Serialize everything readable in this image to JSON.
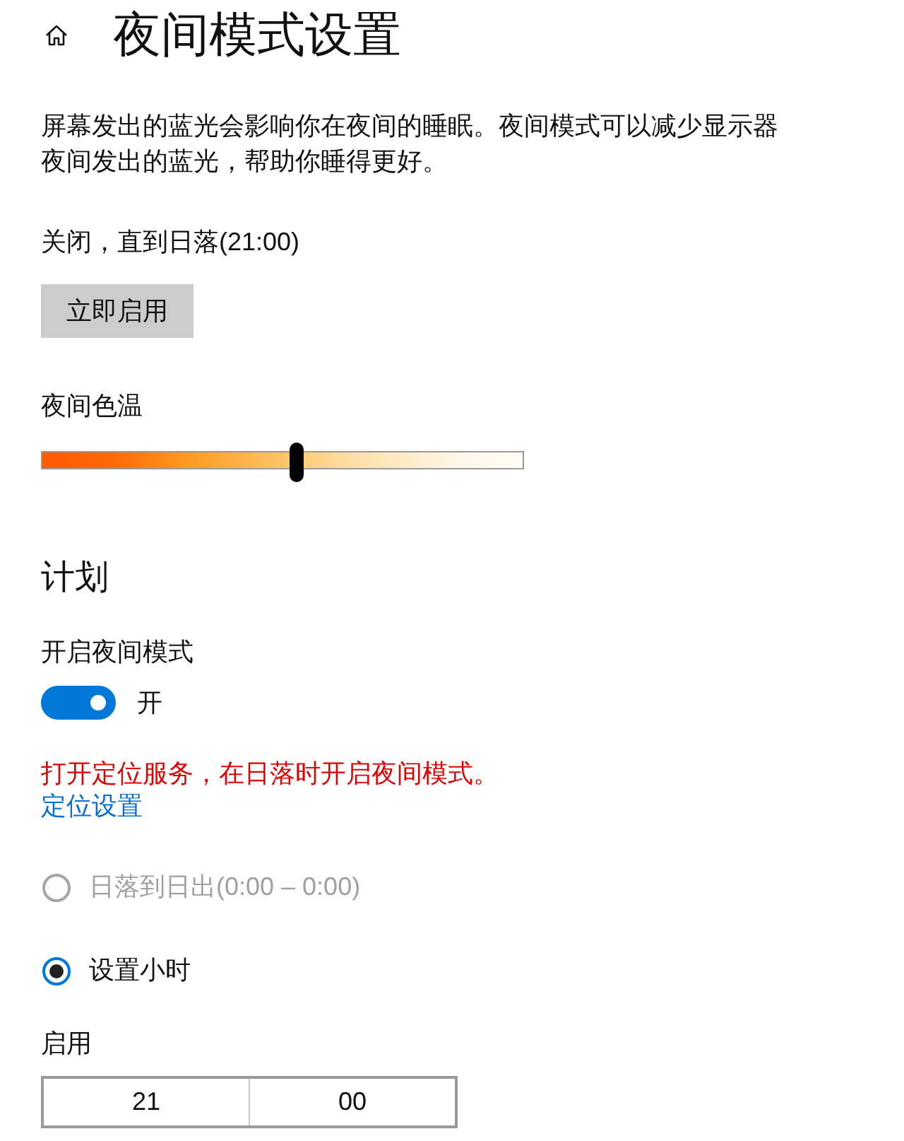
{
  "header": {
    "title": "夜间模式设置"
  },
  "intro": {
    "description": "屏幕发出的蓝光会影响你在夜间的睡眠。夜间模式可以减少显示器夜间发出的蓝光，帮助你睡得更好。",
    "status": "关闭，直到日落(21:00)",
    "action_button": "立即启用"
  },
  "color_temperature": {
    "label": "夜间色温",
    "level": 0.53
  },
  "schedule": {
    "heading": "计划",
    "toggle": {
      "label": "开启夜间模式",
      "on": true,
      "state_text": "开"
    },
    "warning": "打开定位服务，在日落时开启夜间模式。",
    "link": "定位设置",
    "options": [
      {
        "label": "日落到日出(0:00 – 0:00)",
        "selected": false,
        "disabled": true
      },
      {
        "label": "设置小时",
        "selected": true,
        "disabled": false
      }
    ],
    "start": {
      "label": "启用",
      "hour": "21",
      "minute": "00"
    }
  }
}
